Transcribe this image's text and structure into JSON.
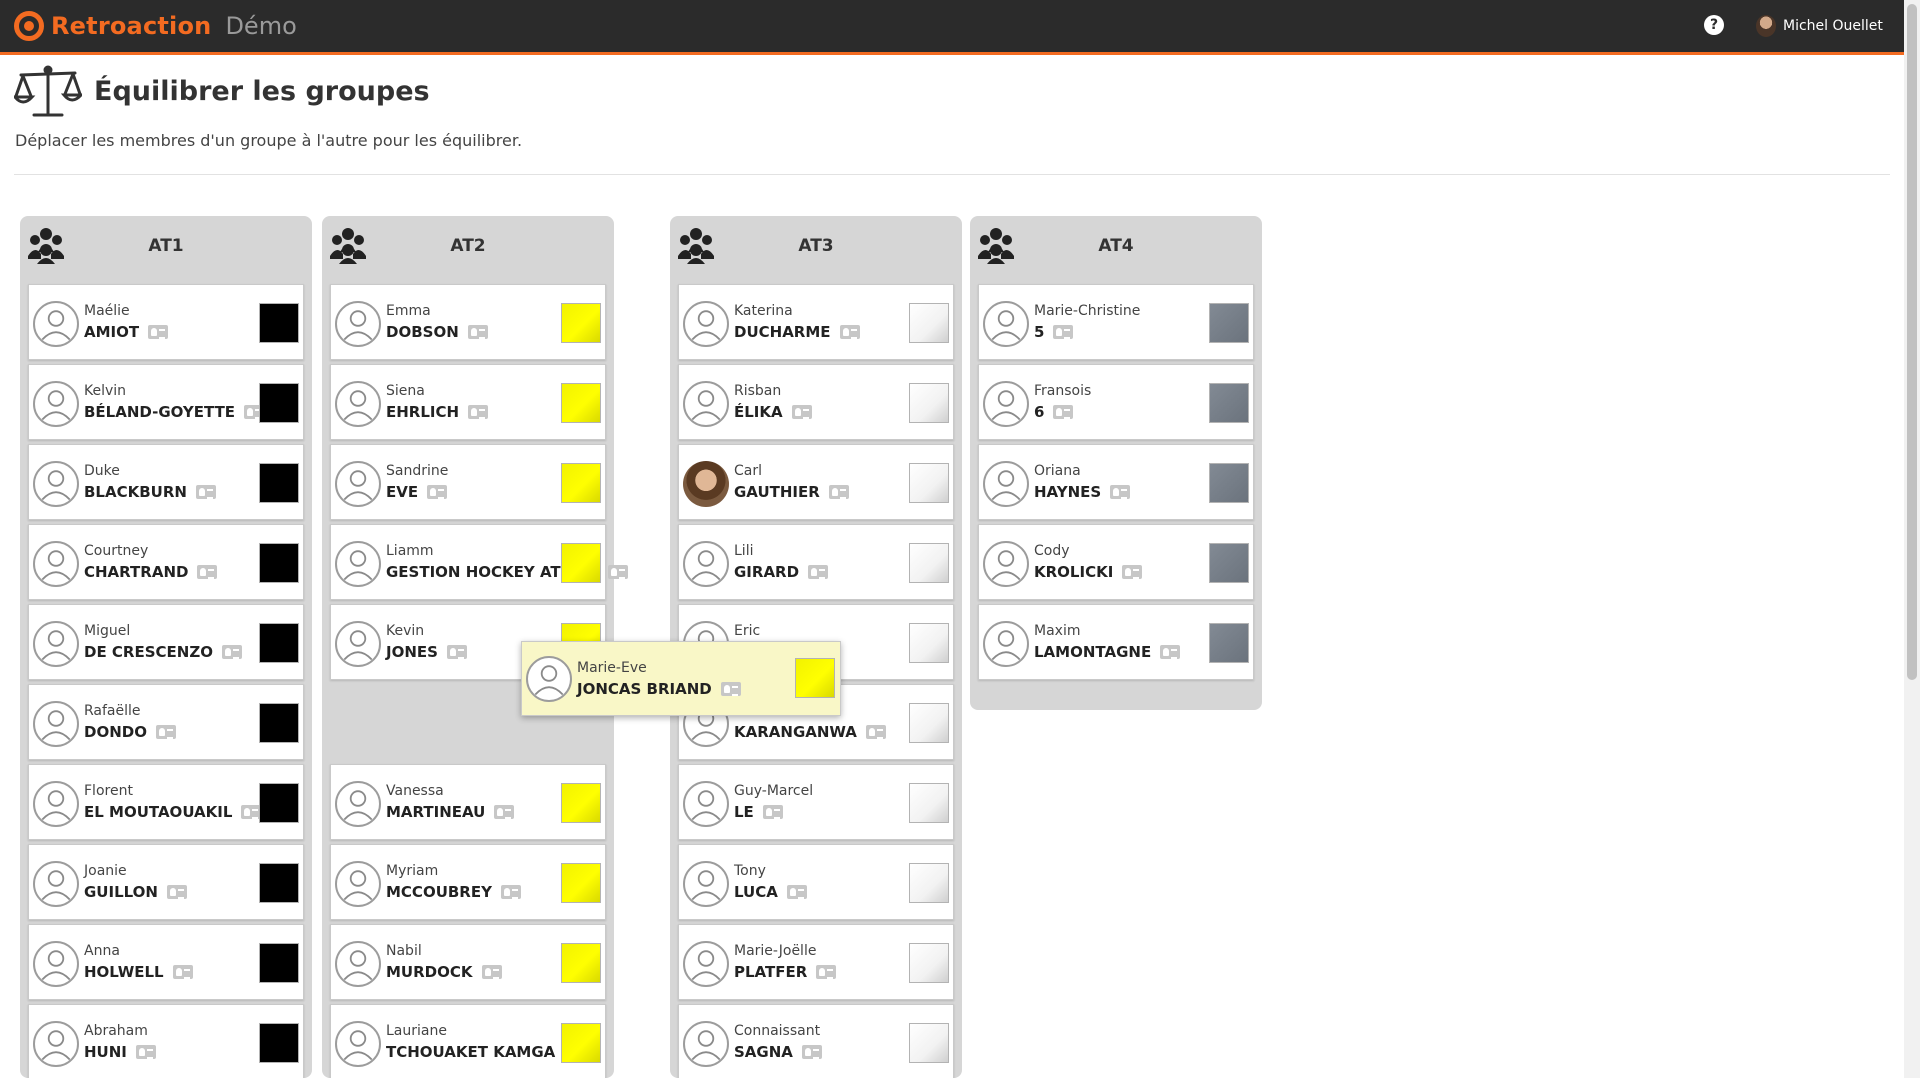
{
  "app": {
    "brand": "Retroaction",
    "env": "Démo",
    "user_name": "Michel Ouellet",
    "accent_color": "#f36b21"
  },
  "icons": {
    "logo": "logo-icon",
    "help": "question-circle-icon",
    "page": "balance-scale-icon",
    "group": "users-icon",
    "card_info": "id-card-icon",
    "avatar_default": "user-outline-icon"
  },
  "page": {
    "title": "Équilibrer les groupes",
    "description": "Déplacer les membres d'un groupe à l'autre pour les équilibrer."
  },
  "groups": [
    {
      "name": "AT1",
      "color": "#000000",
      "members": [
        {
          "first": "Maélie",
          "last": "AMIOT"
        },
        {
          "first": "Kelvin",
          "last": "BÉLAND-GOYETTE"
        },
        {
          "first": "Duke",
          "last": "BLACKBURN"
        },
        {
          "first": "Courtney",
          "last": "CHARTRAND"
        },
        {
          "first": "Miguel",
          "last": "DE CRESCENZO"
        },
        {
          "first": "Rafaëlle",
          "last": "DONDO"
        },
        {
          "first": "Florent",
          "last": "EL MOUTAOUAKIL"
        },
        {
          "first": "Joanie",
          "last": "GUILLON"
        },
        {
          "first": "Anna",
          "last": "HOLWELL"
        },
        {
          "first": "Abraham",
          "last": "HUNI"
        }
      ]
    },
    {
      "name": "AT2",
      "color": "#ffff00",
      "members": [
        {
          "first": "Emma",
          "last": "DOBSON"
        },
        {
          "first": "Siena",
          "last": "EHRLICH"
        },
        {
          "first": "Sandrine",
          "last": "EVE"
        },
        {
          "first": "Liamm",
          "last": "GESTION HOCKEY ATOME"
        },
        {
          "first": "Kevin",
          "last": "JONES"
        },
        {
          "first": "Vanessa",
          "last": "MARTINEAU"
        },
        {
          "first": "Myriam",
          "last": "MCCOUBREY"
        },
        {
          "first": "Nabil",
          "last": "MURDOCK"
        },
        {
          "first": "Lauriane",
          "last": "TCHOUAKET KAMGA"
        }
      ]
    },
    {
      "name": "AT3",
      "color": "#ffffff",
      "members": [
        {
          "first": "Katerina",
          "last": "DUCHARME"
        },
        {
          "first": "Risban",
          "last": "ÉLIKA"
        },
        {
          "first": "Carl",
          "last": "GAUTHIER",
          "photo": true
        },
        {
          "first": "Lili",
          "last": "GIRARD"
        },
        {
          "first": "Eric",
          "last": ""
        },
        {
          "first": "",
          "last": "KARANGANWA"
        },
        {
          "first": "Guy-Marcel",
          "last": "LE"
        },
        {
          "first": "Tony",
          "last": "LUCA"
        },
        {
          "first": "Marie-Joëlle",
          "last": "PLATFER"
        },
        {
          "first": "Connaissant",
          "last": "SAGNA"
        }
      ]
    },
    {
      "name": "AT4",
      "color": "#6e7680",
      "members": [
        {
          "first": "Marie-Christine",
          "last": "5"
        },
        {
          "first": "Fransois",
          "last": "6"
        },
        {
          "first": "Oriana",
          "last": "HAYNES"
        },
        {
          "first": "Cody",
          "last": "KROLICKI"
        },
        {
          "first": "Maxim",
          "last": "LAMONTAGNE"
        }
      ]
    }
  ],
  "dragging": {
    "first": "Marie-Eve",
    "last": "JONCAS BRIAND",
    "color": "#ffff00"
  }
}
